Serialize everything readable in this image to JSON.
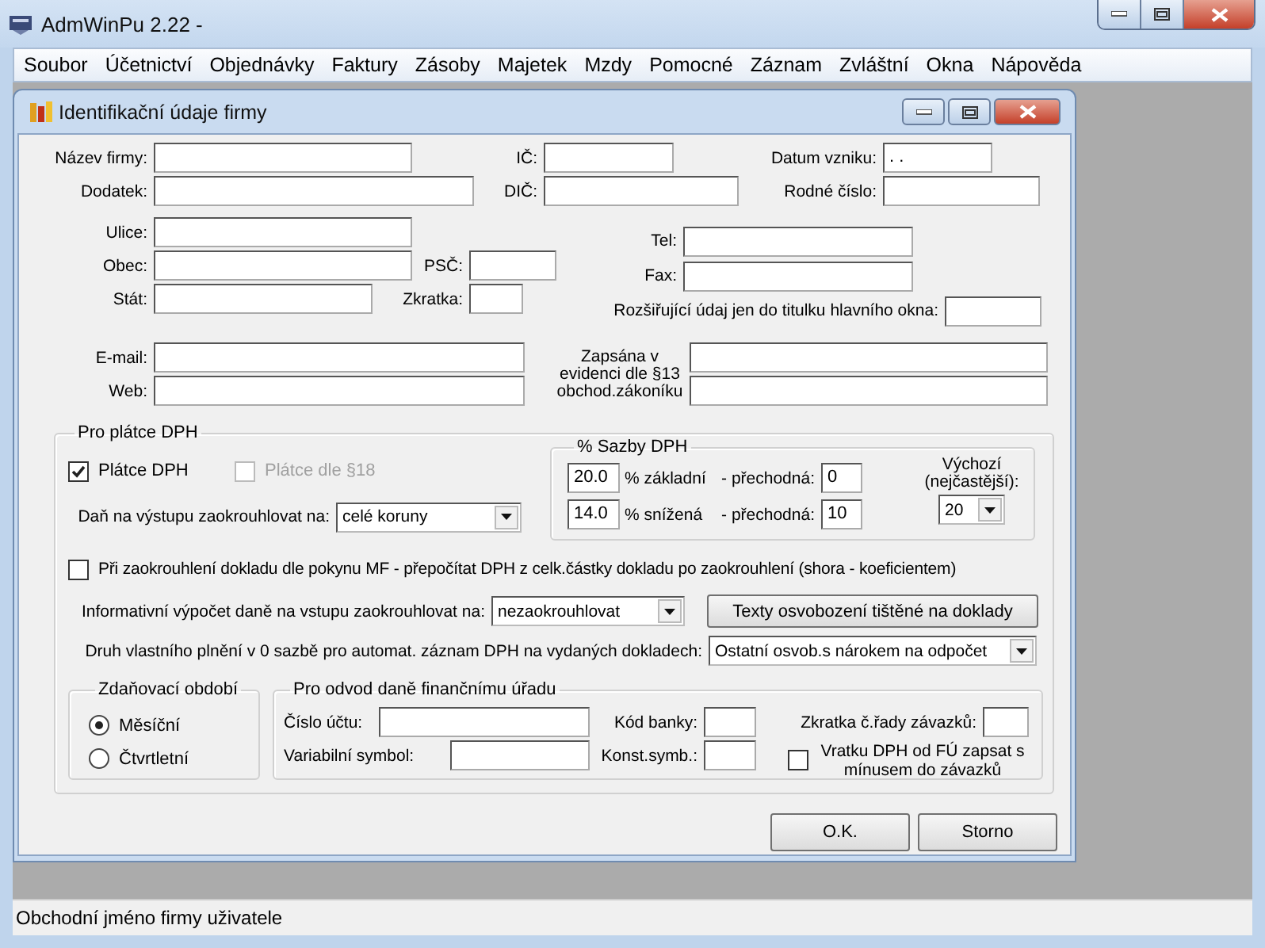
{
  "window": {
    "title": "AdmWinPu 2.22 -"
  },
  "menu": [
    "Soubor",
    "Účetnictví",
    "Objednávky",
    "Faktury",
    "Zásoby",
    "Majetek",
    "Mzdy",
    "Pomocné",
    "Záznam",
    "Zvláštní",
    "Okna",
    "Nápověda"
  ],
  "dialog": {
    "title": "Identifikační údaje firmy",
    "identity": {
      "name": {
        "label": "Název firmy:"
      },
      "ic": {
        "label": "IČ:"
      },
      "founded": {
        "label": "Datum vzniku:",
        "value": ". ."
      },
      "addendum": {
        "label": "Dodatek:"
      },
      "dic": {
        "label": "DIČ:"
      },
      "birth_number": {
        "label": "Rodné číslo:"
      }
    },
    "address": {
      "street": {
        "label": "Ulice:"
      },
      "city": {
        "label": "Obec:"
      },
      "zip": {
        "label": "PSČ:"
      },
      "country": {
        "label": "Stát:"
      },
      "country_code": {
        "label": "Zkratka:"
      },
      "tel": {
        "label": "Tel:"
      },
      "fax": {
        "label": "Fax:"
      },
      "title_extra": {
        "label": "Rozšiřující údaj jen do titulku hlavního okna:"
      },
      "email": {
        "label": "E-mail:"
      },
      "web": {
        "label": "Web:"
      },
      "register": {
        "label": "Zapsána v evidenci dle §13 obchod.zákoníku"
      }
    },
    "vat": {
      "title": "Pro plátce DPH",
      "payer": {
        "label": "Plátce DPH",
        "checked": true
      },
      "payer18": {
        "label": "Plátce dle §18",
        "checked": false,
        "disabled": true
      },
      "rates": {
        "title": "% Sazby DPH",
        "rows": [
          {
            "rate": "20.0",
            "label": "% základní",
            "transitional_label": "- přechodná:",
            "transitional": "0"
          },
          {
            "rate": "14.0",
            "label": "% snížená",
            "transitional_label": "- přechodná:",
            "transitional": "10"
          }
        ],
        "default": {
          "label": "Výchozí (nejčastější):",
          "value": "20"
        }
      },
      "output_rounding": {
        "label": "Daň na výstupu zaokrouhlovat na:",
        "value": "celé koruny"
      },
      "recalc": {
        "label": "Při zaokrouhlení dokladu dle pokynu MF - přepočítat DPH z celk.částky dokladu po zaokrouhlení (shora - koeficientem)",
        "checked": false
      },
      "input_rounding": {
        "label": "Informativní výpočet daně na vstupu zaokrouhlovat na:",
        "value": "nezaokrouhlovat"
      },
      "exemption_button": "Texty osvobození tištěné na doklady",
      "zero_rate": {
        "label": "Druh vlastního plnění v 0 sazbě pro automat. záznam DPH na vydaných dokladech:",
        "value": "Ostatní osvob.s nárokem na odpočet"
      },
      "period": {
        "title": "Zdaňovací období",
        "options": [
          {
            "label": "Měsíční",
            "selected": true
          },
          {
            "label": "Čtvrtletní",
            "selected": false
          }
        ]
      },
      "payment": {
        "title": "Pro odvod daně finančnímu úřadu",
        "account": {
          "label": "Číslo účtu:"
        },
        "bank_code": {
          "label": "Kód banky:"
        },
        "series": {
          "label": "Zkratka č.řady závazků:"
        },
        "var_symbol": {
          "label": "Variabilní symbol:"
        },
        "const_symbol": {
          "label": "Konst.symb.:"
        },
        "refund": {
          "label": "Vratku DPH od FÚ zapsat s mínusem do závazků",
          "checked": false
        }
      }
    },
    "buttons": [
      "O.K.",
      "Storno"
    ]
  },
  "status_bar": "Obchodní jméno firmy uživatele"
}
